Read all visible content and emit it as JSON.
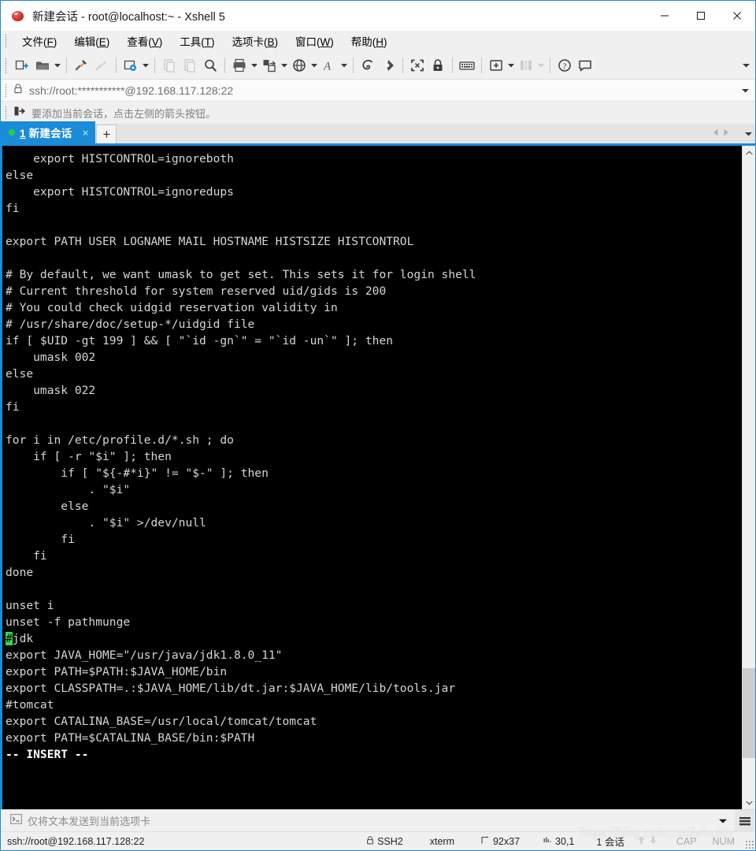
{
  "window": {
    "title": "新建会话 - root@localhost:~ - Xshell 5",
    "app_icon": "xshell-ball-icon",
    "controls": {
      "minimize": "—",
      "maximize": "□",
      "close": "✕"
    },
    "accent_color": "#1a8cd8"
  },
  "menubar": {
    "items": [
      {
        "label": "文件",
        "accel": "F"
      },
      {
        "label": "编辑",
        "accel": "E"
      },
      {
        "label": "查看",
        "accel": "V"
      },
      {
        "label": "工具",
        "accel": "T"
      },
      {
        "label": "选项卡",
        "accel": "B"
      },
      {
        "label": "窗口",
        "accel": "W"
      },
      {
        "label": "帮助",
        "accel": "H"
      }
    ]
  },
  "toolbar": {
    "buttons": [
      {
        "name": "new-session-icon",
        "enabled": true,
        "caret": false
      },
      {
        "name": "open-folder-icon",
        "enabled": true,
        "caret": true
      },
      {
        "name": "sep-1",
        "type": "separator"
      },
      {
        "name": "connect-plug-icon",
        "enabled": true,
        "caret": false
      },
      {
        "name": "disconnect-plug-icon",
        "enabled": false,
        "caret": false
      },
      {
        "name": "sep-2",
        "type": "separator"
      },
      {
        "name": "session-properties-icon",
        "enabled": true,
        "caret": true
      },
      {
        "name": "sep-3",
        "type": "separator"
      },
      {
        "name": "copy-icon",
        "enabled": false,
        "caret": false
      },
      {
        "name": "paste-icon",
        "enabled": false,
        "caret": false
      },
      {
        "name": "find-icon",
        "enabled": true,
        "caret": false
      },
      {
        "name": "sep-4",
        "type": "separator"
      },
      {
        "name": "print-icon",
        "enabled": true,
        "caret": true
      },
      {
        "name": "file-transfer-icon",
        "enabled": true,
        "caret": true
      },
      {
        "name": "globe-icon",
        "enabled": true,
        "caret": true
      },
      {
        "name": "font-icon",
        "enabled": true,
        "caret": true
      },
      {
        "name": "sep-5",
        "type": "separator"
      },
      {
        "name": "log-session-icon",
        "enabled": true,
        "caret": false
      },
      {
        "name": "highlight-icon",
        "enabled": true,
        "caret": false
      },
      {
        "name": "sep-6",
        "type": "separator"
      },
      {
        "name": "fullscreen-icon",
        "enabled": true,
        "caret": false
      },
      {
        "name": "lock-icon",
        "enabled": true,
        "caret": false
      },
      {
        "name": "sep-7",
        "type": "separator"
      },
      {
        "name": "keyboard-icon",
        "enabled": true,
        "caret": false
      },
      {
        "name": "sep-8",
        "type": "separator"
      },
      {
        "name": "add-tab-icon",
        "enabled": true,
        "caret": true
      },
      {
        "name": "layout-icon",
        "enabled": false,
        "caret": true
      },
      {
        "name": "sep-9",
        "type": "separator"
      },
      {
        "name": "help-icon",
        "enabled": true,
        "caret": false
      },
      {
        "name": "chat-icon",
        "enabled": true,
        "caret": false
      }
    ],
    "overflow": "toolbar-overflow-icon"
  },
  "addressbar": {
    "lock_icon": "lock-icon",
    "value": "ssh://root:***********@192.168.117.128:22",
    "dropdown_icon": "chevron-down-icon"
  },
  "notice": {
    "icon": "add-session-arrow-icon",
    "text": "要添加当前会话，点击左侧的箭头按钮。"
  },
  "tabs": {
    "items": [
      {
        "status_dot": "connected",
        "number": "1",
        "label": "新建会话",
        "close": "×",
        "active": true
      }
    ],
    "new_tab_label": "+",
    "nav_prev_icon": "chevron-left-icon",
    "nav_next_icon": "chevron-right-icon",
    "nav_list_icon": "chevron-down-icon"
  },
  "terminal": {
    "rows": [
      {
        "text": "    export HISTCONTROL=ignoreboth"
      },
      {
        "text": "else"
      },
      {
        "text": "    export HISTCONTROL=ignoredups"
      },
      {
        "text": "fi"
      },
      {
        "text": ""
      },
      {
        "text": "export PATH USER LOGNAME MAIL HOSTNAME HISTSIZE HISTCONTROL"
      },
      {
        "text": ""
      },
      {
        "text": "# By default, we want umask to get set. This sets it for login shell"
      },
      {
        "text": "# Current threshold for system reserved uid/gids is 200"
      },
      {
        "text": "# You could check uidgid reservation validity in"
      },
      {
        "text": "# /usr/share/doc/setup-*/uidgid file"
      },
      {
        "text": "if [ $UID -gt 199 ] && [ \"`id -gn`\" = \"`id -un`\" ]; then"
      },
      {
        "text": "    umask 002"
      },
      {
        "text": "else"
      },
      {
        "text": "    umask 022"
      },
      {
        "text": "fi"
      },
      {
        "text": ""
      },
      {
        "text": "for i in /etc/profile.d/*.sh ; do"
      },
      {
        "text": "    if [ -r \"$i\" ]; then"
      },
      {
        "text": "        if [ \"${-#*i}\" != \"$-\" ]; then"
      },
      {
        "text": "            . \"$i\""
      },
      {
        "text": "        else"
      },
      {
        "text": "            . \"$i\" >/dev/null"
      },
      {
        "text": "        fi"
      },
      {
        "text": "    fi"
      },
      {
        "text": "done"
      },
      {
        "text": ""
      },
      {
        "text": "unset i"
      },
      {
        "text": "unset -f pathmunge"
      },
      {
        "text": "#jdk",
        "cursor_at": 0
      },
      {
        "text": "export JAVA_HOME=\"/usr/java/jdk1.8.0_11\""
      },
      {
        "text": "export PATH=$PATH:$JAVA_HOME/bin"
      },
      {
        "text": "export CLASSPATH=.:$JAVA_HOME/lib/dt.jar:$JAVA_HOME/lib/tools.jar"
      },
      {
        "text": "#tomcat"
      },
      {
        "text": "export CATALINA_BASE=/usr/local/tomcat/tomcat"
      },
      {
        "text": "export PATH=$CATALINA_BASE/bin:$PATH"
      },
      {
        "text": "-- INSERT --",
        "bold": true
      }
    ],
    "bg_color": "#000000",
    "fg_color": "#d6d6d6",
    "cursor_color": "#2de04a"
  },
  "scrollbar": {
    "up_icon": "chevron-up-icon",
    "down_icon": "chevron-down-icon",
    "thumb_top_pct": 80,
    "thumb_height_pct": 14
  },
  "sendbar": {
    "icon": "terminal-prompt-icon",
    "text": "仅将文本发送到当前选项卡",
    "dropdown_icon": "chevron-down-icon",
    "menu_icon": "hamburger-menu-icon"
  },
  "statusbar": {
    "connection": "ssh://root@192.168.117.128:22",
    "secure_icon": "lock-icon",
    "protocol": "SSH2",
    "term_type": "xterm",
    "size_icon": "resize-icon",
    "size": "92x37",
    "position_icon": "cursor-position-icon",
    "position": "30,1",
    "sessions": "1 会话",
    "transfer_up_icon": "arrow-up-icon",
    "transfer_down_icon": "arrow-down-icon",
    "caps": "CAP",
    "num": "NUM"
  },
  "watermark": {
    "text": "https://blog.csdn.net/wluckly"
  }
}
